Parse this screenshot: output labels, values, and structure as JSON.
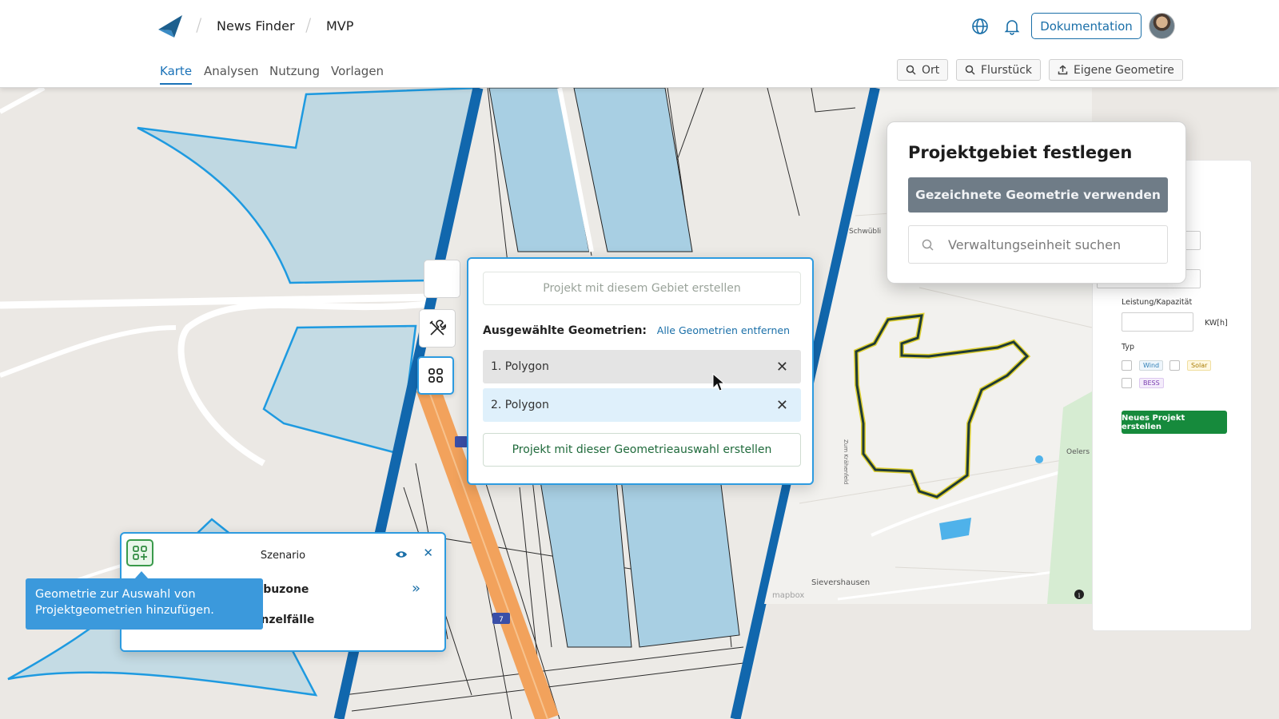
{
  "header": {
    "breadcrumbs": [
      "News Finder",
      "MVP"
    ],
    "tabs": [
      {
        "label": "Karte",
        "active": true
      },
      {
        "label": "Analysen",
        "active": false
      },
      {
        "label": "Nutzung",
        "active": false
      },
      {
        "label": "Vorlagen",
        "active": false
      }
    ],
    "documentation_label": "Dokumentation",
    "tools": [
      {
        "label": "Ort",
        "icon": "search-icon"
      },
      {
        "label": "Flurstück",
        "icon": "search-icon"
      },
      {
        "label": "Eigene Geometire",
        "icon": "upload-icon"
      }
    ]
  },
  "geometry_popup": {
    "create_area_label": "Projekt mit diesem Gebiet erstellen",
    "selected_label": "Ausgewählte Geometrien:",
    "remove_all_label": "Alle Geometrien entfernen",
    "polygons": [
      "1. Polygon",
      "2. Polygon"
    ],
    "create_selection_label": "Projekt mit dieser Geometrieauswahl erstellen"
  },
  "project_area": {
    "title": "Projektgebiet festlegen",
    "use_drawn_label": "Gezeichnete Geometrie verwenden",
    "search_placeholder": "Verwaltungseinheit suchen"
  },
  "side_form": {
    "capacity_label": "Leistung/Kapazität",
    "unit_label": "KW[h]",
    "type_label": "Typ",
    "types": [
      "Wind",
      "Solar",
      "BESS"
    ],
    "submit_label": "Neues Projekt erstellen"
  },
  "map_labels": {
    "place_1": "Schwübli",
    "place_2": "Oelers",
    "place_3": "Sievershausen",
    "road": "Zum Krähenfeld",
    "attribution": "mapbox",
    "highway": "7"
  },
  "scenario": {
    "title": "Szenario",
    "rows": [
      "Tabuzone",
      "Einzelfälle"
    ]
  },
  "tooltip": {
    "text": "Geometrie zur Auswahl von Projektgeometrien hinzufügen."
  },
  "colors": {
    "accent": "#1a72b8",
    "popup_border": "#2d9be0",
    "parcel_fill": "#a8cfe3",
    "highway": "#f2a25c",
    "success": "#168a3c"
  }
}
